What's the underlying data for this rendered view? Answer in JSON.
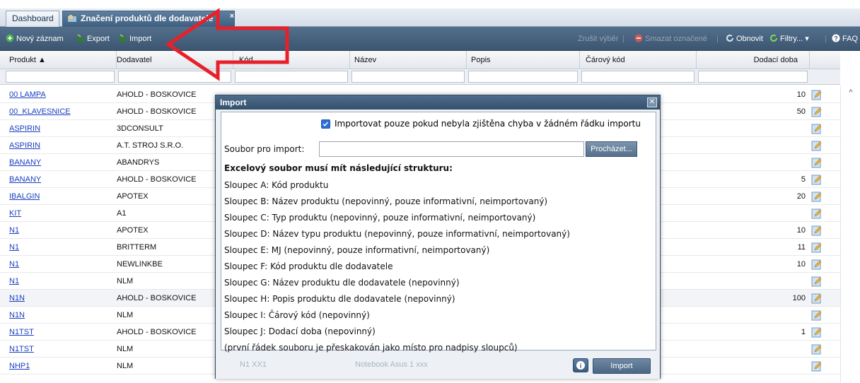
{
  "tabs": {
    "dashboard": "Dashboard",
    "active": "Značení produktů dle dodavatele",
    "close": "×"
  },
  "toolbar": {
    "new_record": "Nový záznam",
    "export": "Export",
    "import": "Import",
    "clear_selection": "Zrušit výběr",
    "delete_marked": "Smazat označené",
    "refresh": "Obnovit",
    "filters": "Filtry...",
    "faq": "FAQ"
  },
  "columns": [
    "Produkt ▲",
    "Dodavatel",
    "Kód",
    "Název",
    "Popis",
    "Čárový kód",
    "Dodací doba"
  ],
  "rows": [
    {
      "product": "00 LAMPA",
      "supplier": "AHOLD - BOSKOVICE",
      "delivery": "10"
    },
    {
      "product": "00_KLAVESNICE",
      "supplier": "AHOLD - BOSKOVICE",
      "delivery": "50"
    },
    {
      "product": "ASPIRIN",
      "supplier": "3DCONSULT",
      "delivery": ""
    },
    {
      "product": "ASPIRIN",
      "supplier": "A.T. STROJ S.R.O.",
      "delivery": ""
    },
    {
      "product": "BANANY",
      "supplier": "ABANDRYS",
      "delivery": ""
    },
    {
      "product": "BANANY",
      "supplier": "AHOLD - BOSKOVICE",
      "delivery": "5"
    },
    {
      "product": "IBALGIN",
      "supplier": "APOTEX",
      "delivery": "20"
    },
    {
      "product": "KIT",
      "supplier": "A1",
      "delivery": ""
    },
    {
      "product": "N1",
      "supplier": "APOTEX",
      "delivery": "10"
    },
    {
      "product": "N1",
      "supplier": "BRITTERM",
      "delivery": "11"
    },
    {
      "product": "N1",
      "supplier": "NEWLINKBE",
      "delivery": "10"
    },
    {
      "product": "N1",
      "supplier": "NLM",
      "delivery": ""
    },
    {
      "product": "N1N",
      "supplier": "AHOLD - BOSKOVICE",
      "delivery": "100"
    },
    {
      "product": "N1N",
      "supplier": "NLM",
      "delivery": ""
    },
    {
      "product": "N1TST",
      "supplier": "AHOLD - BOSKOVICE",
      "delivery": "1"
    },
    {
      "product": "N1TST",
      "supplier": "NLM",
      "delivery": ""
    },
    {
      "product": "NHP1",
      "supplier": "NLM",
      "delivery": ""
    }
  ],
  "modal": {
    "title": "Import",
    "checkbox_label": "Importovat pouze pokud nebyla zjištěna chyba v žádném řádku importu",
    "checkbox_checked": true,
    "file_label": "Soubor pro import:",
    "file_value": "",
    "browse": "Procházet...",
    "structure_heading": "Excelový soubor musí mít následující strukturu:",
    "lines": [
      "Sloupec A: Kód produktu",
      "Sloupec B: Název produktu (nepovinný, pouze informativní, neimportovaný)",
      "Sloupec C: Typ produktu (nepovinný, pouze informativní, neimportovaný)",
      "Sloupec D: Název typu produktu (nepovinný, pouze informativní, neimportovaný)",
      "Sloupec E: MJ (nepovinný, pouze informativní, neimportovaný)",
      "Sloupec F: Kód produktu dle dodavatele",
      "Sloupec G: Název produktu dle dodavatele (nepovinný)",
      "Sloupec H: Popis produktu dle dodavatele (nepovinný)",
      "Sloupec I: Čárový kód (nepovinný)",
      "Sloupec J: Dodací doba (nepovinný)",
      "(první řádek souboru je přeskakován jako místo pro nadpisy sloupců)"
    ],
    "footer_ghost_code": "N1 XX1",
    "footer_ghost_name": "Notebook Asus 1 xxx",
    "import_button": "Import"
  },
  "colors": {
    "toolbar": "#3c5671",
    "accent_red": "#e8202a",
    "link": "#1a3fbf"
  }
}
